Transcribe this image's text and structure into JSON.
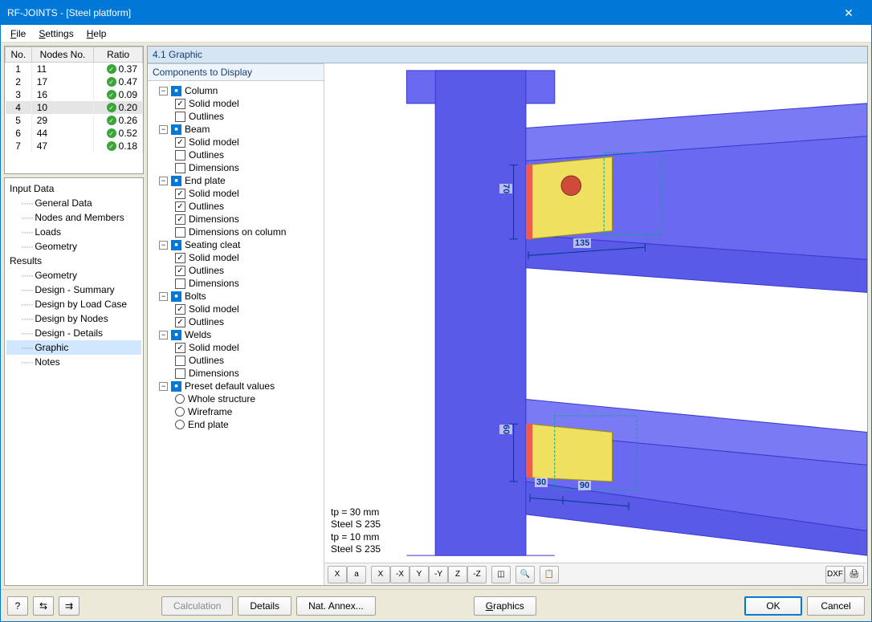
{
  "window": {
    "title": "RF-JOINTS - [Steel platform]"
  },
  "menu": {
    "file": "File",
    "settings": "Settings",
    "help": "Help"
  },
  "table": {
    "headers": {
      "no": "No.",
      "nodes": "Nodes No.",
      "ratio": "Ratio"
    },
    "rows": [
      {
        "no": "1",
        "nodes": "11",
        "ratio": "0.37"
      },
      {
        "no": "2",
        "nodes": "17",
        "ratio": "0.47"
      },
      {
        "no": "3",
        "nodes": "16",
        "ratio": "0.09"
      },
      {
        "no": "4",
        "nodes": "10",
        "ratio": "0.20",
        "selected": true
      },
      {
        "no": "5",
        "nodes": "29",
        "ratio": "0.26"
      },
      {
        "no": "6",
        "nodes": "44",
        "ratio": "0.52"
      },
      {
        "no": "7",
        "nodes": "47",
        "ratio": "0.18"
      }
    ]
  },
  "nav": {
    "input_data": "Input Data",
    "input_items": [
      "General Data",
      "Nodes and Members",
      "Loads",
      "Geometry"
    ],
    "results": "Results",
    "result_items": [
      "Geometry",
      "Design - Summary",
      "Design by Load Case",
      "Design by Nodes",
      "Design - Details",
      "Graphic",
      "Notes"
    ],
    "selected": "Graphic"
  },
  "main": {
    "caption": "4.1 Graphic",
    "tree_header": "Components to Display",
    "tree": [
      {
        "label": "Column",
        "state": "mixed",
        "children": [
          {
            "label": "Solid model",
            "checked": true
          },
          {
            "label": "Outlines",
            "checked": false
          }
        ]
      },
      {
        "label": "Beam",
        "state": "mixed",
        "children": [
          {
            "label": "Solid model",
            "checked": true
          },
          {
            "label": "Outlines",
            "checked": false
          },
          {
            "label": "Dimensions",
            "checked": false
          }
        ]
      },
      {
        "label": "End plate",
        "state": "mixed",
        "children": [
          {
            "label": "Solid model",
            "checked": true
          },
          {
            "label": "Outlines",
            "checked": true
          },
          {
            "label": "Dimensions",
            "checked": true
          },
          {
            "label": "Dimensions on column",
            "checked": false
          }
        ]
      },
      {
        "label": "Seating cleat",
        "state": "mixed",
        "children": [
          {
            "label": "Solid model",
            "checked": true
          },
          {
            "label": "Outlines",
            "checked": true
          },
          {
            "label": "Dimensions",
            "checked": false
          }
        ]
      },
      {
        "label": "Bolts",
        "state": "mixed",
        "children": [
          {
            "label": "Solid model",
            "checked": true
          },
          {
            "label": "Outlines",
            "checked": true
          }
        ]
      },
      {
        "label": "Welds",
        "state": "mixed",
        "children": [
          {
            "label": "Solid model",
            "checked": true
          },
          {
            "label": "Outlines",
            "checked": false
          },
          {
            "label": "Dimensions",
            "checked": false
          }
        ]
      },
      {
        "label": "Preset default values",
        "state": "mixed",
        "children": [
          {
            "label": "Whole structure",
            "radio": true
          },
          {
            "label": "Wireframe",
            "radio": true
          },
          {
            "label": "End plate",
            "radio": true
          }
        ]
      }
    ],
    "annotations": [
      "tp = 30 mm",
      "Steel S 235",
      "tp = 10 mm",
      "Steel S 235"
    ],
    "dimensions": {
      "top_v": "70",
      "top_h": "135",
      "bot_v": "60",
      "bot_h1": "30",
      "bot_h2": "90"
    }
  },
  "vp_toolbar": {
    "left": [
      "X",
      "a",
      "X",
      "-X",
      "Y",
      "-Y",
      "Z",
      "-Z",
      "iso",
      "zoom",
      "layer"
    ],
    "right": [
      "DXF",
      "print"
    ]
  },
  "footer": {
    "help": "?",
    "b1": "⇆",
    "b2": "⇉",
    "calculation": "Calculation",
    "details": "Details",
    "nat_annex": "Nat. Annex...",
    "graphics": "Graphics",
    "ok": "OK",
    "cancel": "Cancel"
  }
}
